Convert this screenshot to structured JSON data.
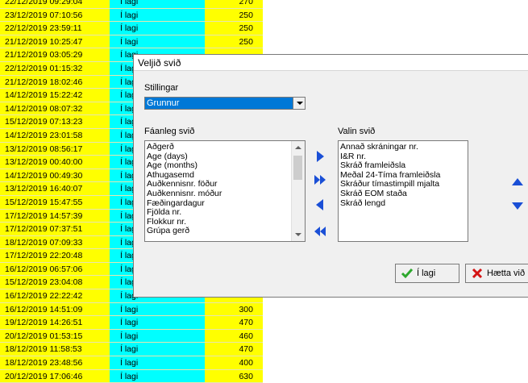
{
  "grid_rows": [
    {
      "date": "22/12/2019 09:29:04",
      "status": "Í lagi",
      "value": "270"
    },
    {
      "date": "23/12/2019 07:10:56",
      "status": "Í lagi",
      "value": "250"
    },
    {
      "date": "22/12/2019 23:59:11",
      "status": "Í lagi",
      "value": "250"
    },
    {
      "date": "21/12/2019 10:25:47",
      "status": "Í lagi",
      "value": "250"
    },
    {
      "date": "21/12/2019 03:05:29",
      "status": "Í lagi",
      "value": ""
    },
    {
      "date": "22/12/2019 01:15:32",
      "status": "Í lagi",
      "value": ""
    },
    {
      "date": "21/12/2019 18:02:46",
      "status": "Í lagi",
      "value": ""
    },
    {
      "date": "14/12/2019 15:22:42",
      "status": "Í lagi",
      "value": ""
    },
    {
      "date": "14/12/2019 08:07:32",
      "status": "Í lagi",
      "value": ""
    },
    {
      "date": "15/12/2019 07:13:23",
      "status": "Í lagi",
      "value": ""
    },
    {
      "date": "14/12/2019 23:01:58",
      "status": "Í lagi",
      "value": ""
    },
    {
      "date": "13/12/2019 08:56:17",
      "status": "Í lagi",
      "value": ""
    },
    {
      "date": "13/12/2019 00:40:00",
      "status": "Í lagi",
      "value": ""
    },
    {
      "date": "14/12/2019 00:49:30",
      "status": "Í lagi",
      "value": ""
    },
    {
      "date": "13/12/2019 16:40:07",
      "status": "Í lagi",
      "value": ""
    },
    {
      "date": "15/12/2019 15:47:55",
      "status": "Í lagi",
      "value": ""
    },
    {
      "date": "17/12/2019 14:57:39",
      "status": "Í lagi",
      "value": ""
    },
    {
      "date": "17/12/2019 07:37:51",
      "status": "Í lagi",
      "value": ""
    },
    {
      "date": "18/12/2019 07:09:33",
      "status": "Í lagi",
      "value": ""
    },
    {
      "date": "17/12/2019 22:20:48",
      "status": "Í lagi",
      "value": ""
    },
    {
      "date": "16/12/2019 06:57:06",
      "status": "Í lagi",
      "value": ""
    },
    {
      "date": "15/12/2019 23:04:08",
      "status": "Í lagi",
      "value": ""
    },
    {
      "date": "16/12/2019 22:22:42",
      "status": "Í lagi",
      "value": ""
    },
    {
      "date": "16/12/2019 14:51:09",
      "status": "Í lagi",
      "value": "300"
    },
    {
      "date": "19/12/2019 14:26:51",
      "status": "Í lagi",
      "value": "470"
    },
    {
      "date": "20/12/2019 01:53:15",
      "status": "Í lagi",
      "value": "460"
    },
    {
      "date": "18/12/2019 11:58:53",
      "status": "Í lagi",
      "value": "470"
    },
    {
      "date": "18/12/2019 23:48:56",
      "status": "Í lagi",
      "value": "400"
    },
    {
      "date": "20/12/2019 17:06:46",
      "status": "Í lagi",
      "value": "630"
    }
  ],
  "dialog": {
    "title": "Veljið svið",
    "settings_label": "Stillingar",
    "settings_value": "Grunnur",
    "available_label": "Fáanleg svið",
    "available_items": [
      "Aðgerð",
      "Age (days)",
      "Age (months)",
      "Athugasemd",
      "Auðkennisnr. föður",
      "Auðkennisnr. móður",
      "Fæðingardagur",
      "Fjölda nr.",
      "Flokkur nr.",
      "Grúpa gerð"
    ],
    "chosen_label": "Valin svið",
    "chosen_items": [
      "Annað skráningar nr.",
      "I&R nr.",
      "Skráð framleiðsla",
      "Meðal 24-Tíma framleiðsla",
      "Skráður tímastimpill mjalta",
      "Skráð EOM staða",
      "Skráð lengd"
    ],
    "ok_label": "Í lagi",
    "cancel_label": "Hætta við"
  },
  "colors": {
    "date_bg": "#ffff00",
    "status_bg": "#00ffff",
    "value_bg": "#ffff00",
    "select_highlight": "#0078d7",
    "arrow_blue": "#1a4fd6",
    "ok_green": "#2da82d",
    "cancel_red": "#d41414"
  },
  "icons": {
    "add": "arrow-right-icon",
    "add_all": "double-arrow-right-icon",
    "remove": "arrow-left-icon",
    "remove_all": "double-arrow-left-icon",
    "up": "arrow-up-icon",
    "down": "arrow-down-icon",
    "ok": "checkmark-icon",
    "cancel": "x-icon"
  }
}
